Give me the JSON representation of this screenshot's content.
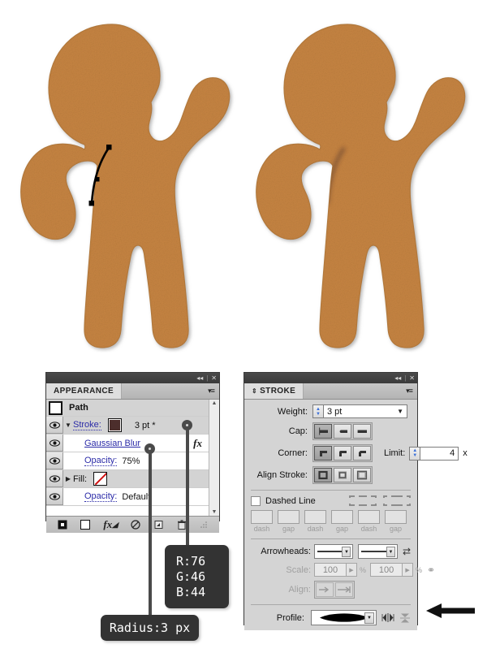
{
  "canvas": {
    "background": "#ffffff",
    "body_color": "#c68442",
    "body_edge_color": "#b57a3c",
    "shade_color": "#4c2e2c",
    "path_color": "#000000"
  },
  "artwork": {
    "left_figure": {
      "name": "gingerbread-man-with-selected-path",
      "selected_path_anchors": 3
    },
    "right_figure": {
      "name": "gingerbread-man-with-blurred-shadow-stroke"
    }
  },
  "appearance_panel": {
    "tab_label": "APPEARANCE",
    "collapse_icon": "◂◂",
    "close_icon": "✕",
    "menu_icon": "▾≡",
    "target_label": "Path",
    "rows": [
      {
        "id": "stroke",
        "disclosure": "▼",
        "label": "Stroke:",
        "swatch": "#4c2e2c",
        "value": "3 pt *",
        "visible": true
      },
      {
        "id": "gaussian-blur",
        "disclosure": "",
        "label": "Gaussian Blur",
        "value": "",
        "fx_badge": "fx",
        "visible": true
      },
      {
        "id": "stroke-opacity",
        "disclosure": "",
        "label": "Opacity:",
        "value": "75%",
        "visible": true
      },
      {
        "id": "fill",
        "disclosure": "▶",
        "label": "Fill:",
        "swatch": "none",
        "value": "",
        "visible": true
      },
      {
        "id": "object-opacity",
        "disclosure": "",
        "label": "Opacity:",
        "value": "Default",
        "visible": true
      }
    ],
    "footer_buttons": [
      {
        "id": "add-new-stroke",
        "icon": "■"
      },
      {
        "id": "add-new-fill",
        "icon": "□"
      },
      {
        "id": "add-new-effect",
        "icon": "fx,"
      },
      {
        "id": "clear-appearance",
        "icon": "⊘"
      },
      {
        "id": "duplicate-item",
        "icon": "⧉"
      },
      {
        "id": "delete-item",
        "icon": "Ὕ1"
      }
    ],
    "scroll_up": "▲",
    "scroll_down": "▼"
  },
  "stroke_panel": {
    "tab_label": "STROKE",
    "tab_grip": "⇕",
    "collapse_icon": "◂◂",
    "close_icon": "✕",
    "menu_icon": "▾≡",
    "weight": {
      "label": "Weight:",
      "value": "3 pt"
    },
    "cap": {
      "label": "Cap:",
      "selected_index": 0,
      "options": [
        "butt-cap",
        "round-cap",
        "projecting-cap"
      ]
    },
    "corner": {
      "label": "Corner:",
      "selected_index": 0,
      "options": [
        "miter-join",
        "round-join",
        "bevel-join"
      ]
    },
    "limit": {
      "label": "Limit:",
      "value": "4",
      "unit": "x"
    },
    "align_stroke": {
      "label": "Align Stroke:",
      "selected_index": 0,
      "options": [
        "align-center",
        "align-inside",
        "align-outside"
      ]
    },
    "dashed_line": {
      "label": "Dashed Line",
      "checked": false
    },
    "dash_fields": [
      "",
      "",
      "",
      "",
      "",
      ""
    ],
    "dash_labels": [
      "dash",
      "gap",
      "dash",
      "gap",
      "dash",
      "gap"
    ],
    "arrowheads": {
      "label": "Arrowheads:",
      "start": "",
      "end": "",
      "swap_icon": "⇄"
    },
    "scale": {
      "label": "Scale:",
      "start": "100",
      "end": "100",
      "unit": "%",
      "link_icon": "⚭",
      "enabled": false
    },
    "align_arrow": {
      "label": "Align:",
      "enabled": false
    },
    "profile": {
      "label": "Profile:",
      "value": "width-profile-1",
      "flip_across_icon": "⋈",
      "flip_along_icon": "⧖"
    }
  },
  "callouts": [
    {
      "id": "rgb-callout",
      "lines": [
        "R:76",
        "G:46",
        "B:44"
      ]
    },
    {
      "id": "radius-callout",
      "lines": [
        "Radius:3 px"
      ]
    }
  ],
  "pointer": {
    "id": "profile-pointer-arrow",
    "direction": "left"
  }
}
